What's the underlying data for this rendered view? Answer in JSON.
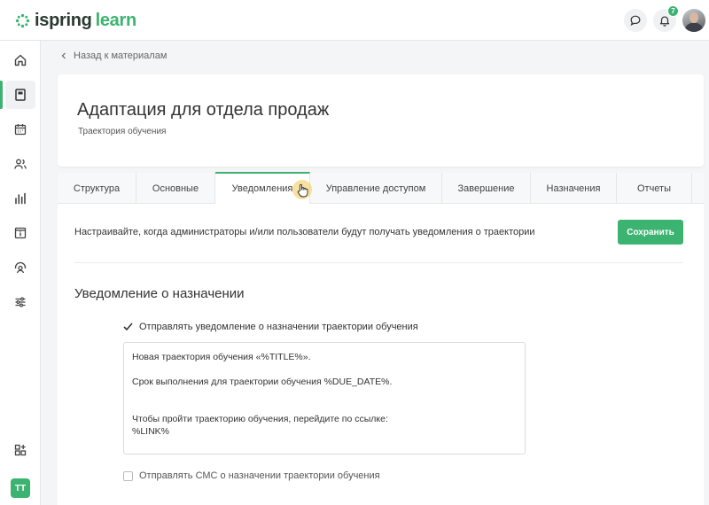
{
  "app": {
    "logo_part1": "ispring",
    "logo_part2": "learn",
    "brand_color": "#3cb371"
  },
  "topbar": {
    "notification_count": "7"
  },
  "sidebar": {
    "items": [
      "home-icon",
      "book-icon",
      "calendar-icon",
      "users-icon",
      "chart-icon",
      "info-card-icon",
      "support-icon",
      "sliders-icon",
      "apps-add-icon"
    ],
    "active_item": "book-icon",
    "user_initials": "TT"
  },
  "breadcrumb": {
    "back_label": "Назад к материалам"
  },
  "header": {
    "title": "Адаптация для отдела продаж",
    "subtitle": "Траектория обучения"
  },
  "tabs": [
    {
      "label": "Структура"
    },
    {
      "label": "Основные"
    },
    {
      "label": "Уведомления",
      "active": true
    },
    {
      "label": "Управление доступом"
    },
    {
      "label": "Завершение"
    },
    {
      "label": "Назначения"
    },
    {
      "label": "Отчеты"
    }
  ],
  "main": {
    "intro": "Настраивайте, когда администраторы и/или пользователи будут получать уведомления о траектории",
    "save_label": "Сохранить",
    "section_title": "Уведомление о назначении",
    "notify_checkbox": {
      "label": "Отправлять уведомление о назначении траектории обучения",
      "checked": true
    },
    "message_lines": [
      "Новая траектория обучения «%TITLE%».",
      "",
      "Срок выполнения для траектории обучения %DUE_DATE%.",
      "",
      "",
      "Чтобы пройти траекторию обучения, перейдите по ссылке:",
      "%LINK%"
    ],
    "sms_checkbox": {
      "label": "Отправлять СМС о назначении траектории обучения",
      "checked": false
    }
  }
}
